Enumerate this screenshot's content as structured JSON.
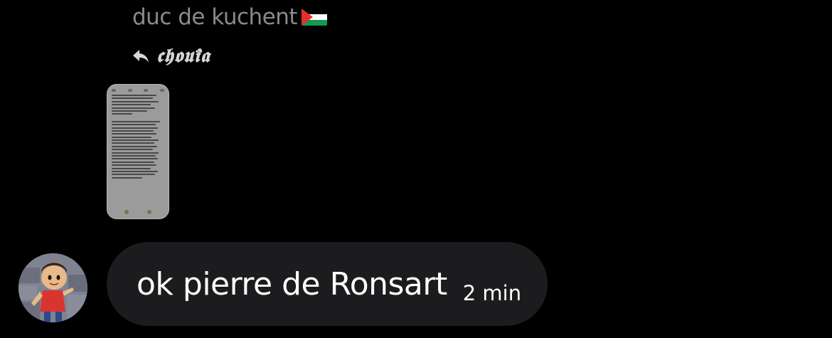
{
  "reply": {
    "sender_name": "duc de kuchent",
    "sender_flag_icon": "palestine-flag-icon",
    "replied_to_name": "𝖈𝖍𝖔𝖚𝖎̈𝖆",
    "reply_icon": "reply-arrow-icon"
  },
  "attachment": {
    "type": "screenshot-thumbnail",
    "icon": "phone-screenshot-thumbnail"
  },
  "message": {
    "text": "ok pierre de Ronsart",
    "timestamp": "2 min",
    "avatar_icon": "avatar-character-icon"
  },
  "colors": {
    "background": "#000000",
    "bubble": "#1c1c1e",
    "sender_name": "#8a8a8e",
    "flag_black": "#000000",
    "flag_white": "#ffffff",
    "flag_green": "#149954",
    "flag_red": "#e4312b"
  }
}
